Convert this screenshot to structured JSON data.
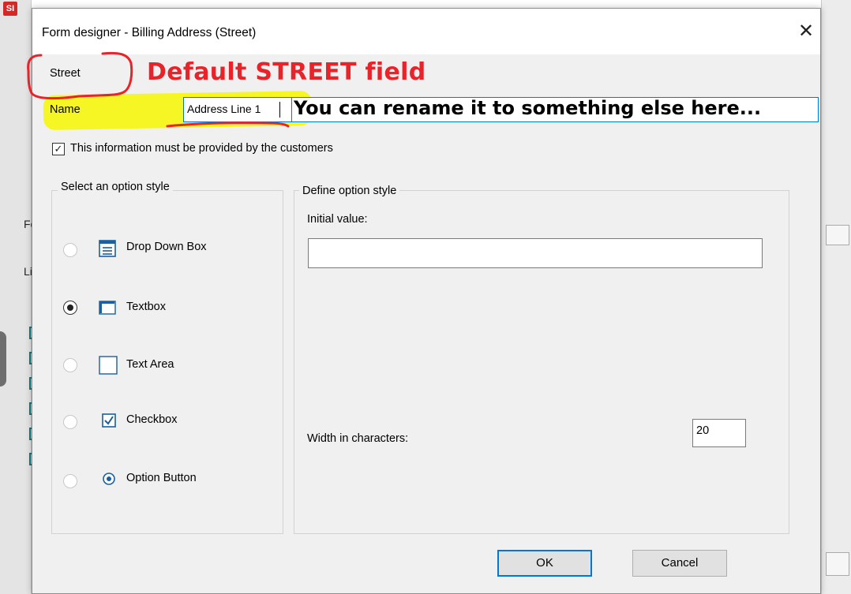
{
  "background": {
    "app_icon": "SI",
    "fragments": [
      "Fo",
      "Li"
    ]
  },
  "dialog": {
    "title": "Form designer - Billing Address (Street)",
    "field_label": "Street",
    "name_label": "Name",
    "name_value": "Address Line 1",
    "required_checkbox": {
      "label": "This information must be provided by the customers",
      "checked": true
    },
    "option_style_group": {
      "title": "Select an option style",
      "options": [
        {
          "label": "Drop Down Box",
          "icon": "dropdown-icon",
          "selected": false
        },
        {
          "label": "Textbox",
          "icon": "textbox-icon",
          "selected": true
        },
        {
          "label": "Text Area",
          "icon": "textarea-icon",
          "selected": false
        },
        {
          "label": "Checkbox",
          "icon": "checkbox-icon",
          "selected": false
        },
        {
          "label": "Option Button",
          "icon": "option-button-icon",
          "selected": false
        }
      ]
    },
    "define_group": {
      "title": "Define option style",
      "initial_value_label": "Initial value:",
      "initial_value": "",
      "width_label": "Width in characters:",
      "width_value": "20"
    },
    "buttons": {
      "ok": "OK",
      "cancel": "Cancel"
    }
  },
  "annotations": {
    "red_title": "Default STREET field",
    "black_note": "You can rename it to something else here..."
  },
  "colors": {
    "accent": "#0078d7",
    "annotation_red": "#e8232a",
    "highlight_yellow": "#f7f700"
  }
}
